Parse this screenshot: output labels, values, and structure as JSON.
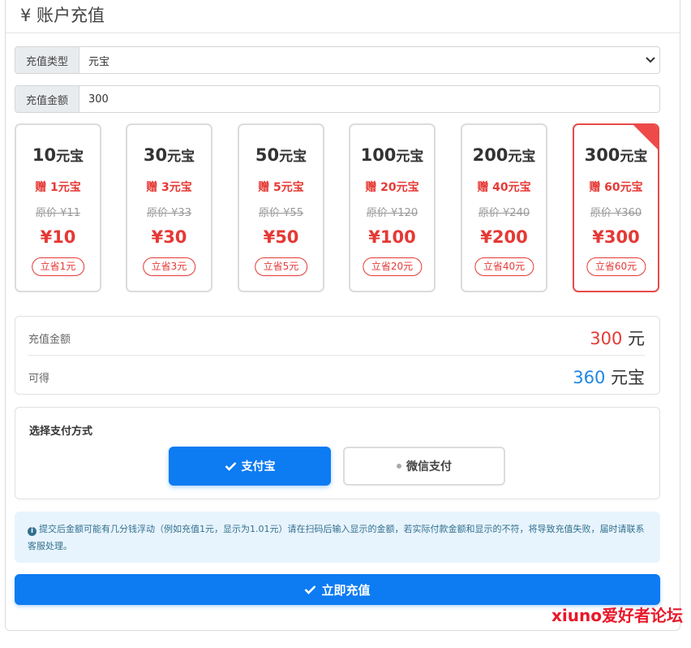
{
  "header": {
    "title": "¥ 账户充值"
  },
  "recharge_type": {
    "label": "充值类型",
    "value": "元宝"
  },
  "recharge_amount": {
    "label": "充值金额",
    "value": "300"
  },
  "packages": [
    {
      "num": "10",
      "unit": "元宝",
      "bonus": "赠 1元宝",
      "orig": "原价 ¥11",
      "price": "¥10",
      "save": "立省1元",
      "selected": false
    },
    {
      "num": "30",
      "unit": "元宝",
      "bonus": "赠 3元宝",
      "orig": "原价 ¥33",
      "price": "¥30",
      "save": "立省3元",
      "selected": false
    },
    {
      "num": "50",
      "unit": "元宝",
      "bonus": "赠 5元宝",
      "orig": "原价 ¥55",
      "price": "¥50",
      "save": "立省5元",
      "selected": false
    },
    {
      "num": "100",
      "unit": "元宝",
      "bonus": "赠 20元宝",
      "orig": "原价 ¥120",
      "price": "¥100",
      "save": "立省20元",
      "selected": false
    },
    {
      "num": "200",
      "unit": "元宝",
      "bonus": "赠 40元宝",
      "orig": "原价 ¥240",
      "price": "¥200",
      "save": "立省40元",
      "selected": false
    },
    {
      "num": "300",
      "unit": "元宝",
      "bonus": "赠 60元宝",
      "orig": "原价 ¥360",
      "price": "¥300",
      "save": "立省60元",
      "selected": true
    }
  ],
  "summary": {
    "amount_label": "充值金额",
    "amount_value": "300",
    "amount_unit": "元",
    "gain_label": "可得",
    "gain_value": "360",
    "gain_unit": "元宝"
  },
  "payment": {
    "title": "选择支付方式",
    "alipay_label": "支付宝",
    "wechat_label": "微信支付",
    "selected": "alipay"
  },
  "notice": {
    "text": "提交后金额可能有几分钱浮动（例如充值1元，显示为1.01元）请在扫码后输入显示的金额，若实际付款金额和显示的不符，将导致充值失败，届时请联系客服处理。"
  },
  "submit": {
    "label": "立即充值"
  },
  "watermark": {
    "text": "xiuno爱好者论坛"
  },
  "colors": {
    "primary": "#0d7bf2",
    "danger": "#e53935",
    "gain": "#1e88e5",
    "notice_bg": "#e8f4fd"
  }
}
